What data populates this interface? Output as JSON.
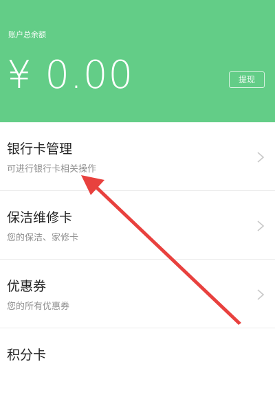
{
  "balance": {
    "label": "账户总余额",
    "amount": "¥ 0.00",
    "withdraw_label": "提现"
  },
  "menu": {
    "items": [
      {
        "title": "银行卡管理",
        "subtitle": "可进行银行卡相关操作",
        "icon": "chevron-right-icon"
      },
      {
        "title": "保洁维修卡",
        "subtitle": "您的保洁、家修卡",
        "icon": "chevron-right-icon"
      },
      {
        "title": "优惠券",
        "subtitle": "您的所有优惠券",
        "icon": "chevron-right-icon"
      },
      {
        "title": "积分卡",
        "subtitle": "",
        "icon": "chevron-right-icon"
      }
    ]
  },
  "colors": {
    "header_green": "#63cd87",
    "arrow_red": "#e8413e"
  }
}
